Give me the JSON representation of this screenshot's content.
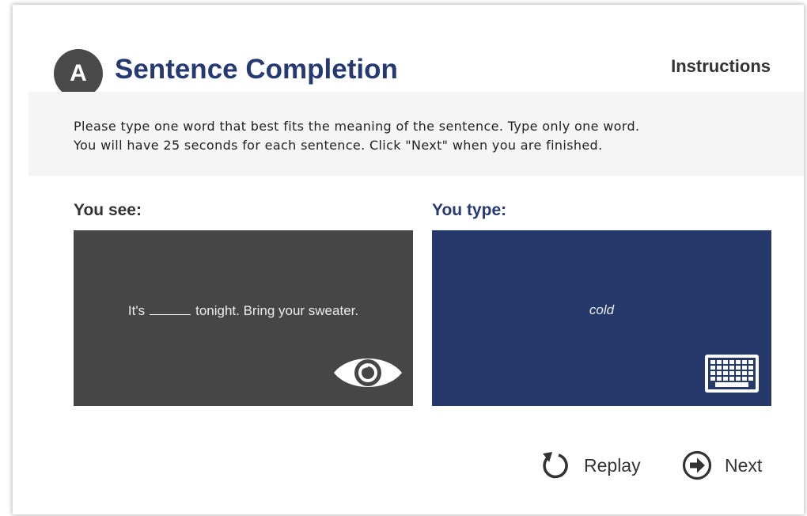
{
  "header": {
    "badge_letter": "A",
    "title": "Sentence Completion",
    "instructions_label": "Instructions"
  },
  "instructions": {
    "line1": "Please type one word that best fits the meaning of the sentence. Type only one word.",
    "line2": "You will have 25 seconds for each sentence. Click \"Next\" when you are finished."
  },
  "see": {
    "label": "You see:",
    "sentence_before": "It's",
    "sentence_after": "tonight. Bring your sweater.",
    "icon": "eye-icon"
  },
  "type": {
    "label": "You type:",
    "typed_answer": "cold",
    "icon": "keyboard-icon"
  },
  "footer": {
    "replay_label": "Replay",
    "next_label": "Next"
  },
  "colors": {
    "accent_navy": "#253a73",
    "see_panel": "#464646",
    "type_panel": "#253a6b",
    "badge": "#4a4a4a"
  }
}
